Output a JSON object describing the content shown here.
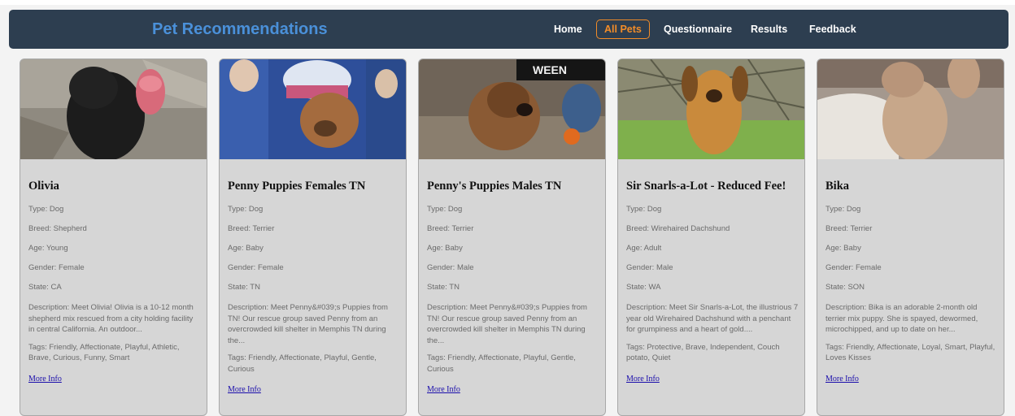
{
  "brand": "Pet Recommendations",
  "nav": [
    {
      "label": "Home",
      "active": false
    },
    {
      "label": "All Pets",
      "active": true
    },
    {
      "label": "Questionnaire",
      "active": false
    },
    {
      "label": "Results",
      "active": false
    },
    {
      "label": "Feedback",
      "active": false
    }
  ],
  "colors": {
    "navbar_bg": "#2d3e50",
    "brand": "#4a90d9",
    "active_nav": "#f28c28",
    "card_bg": "#d6d6d6",
    "link": "#1a0dab"
  },
  "pets": [
    {
      "name": "Olivia",
      "type": "Type: Dog",
      "breed": "Breed: Shepherd",
      "age": "Age: Young",
      "gender": "Gender: Female",
      "state": "State: CA",
      "description": "Description: Meet Olivia! Olivia is a 10-12 month shepherd mix rescued from a city holding facility in central California. An outdoor...",
      "tags": "Tags: Friendly, Affectionate, Playful, Athletic, Brave, Curious, Funny, Smart",
      "more": "More Info"
    },
    {
      "name": "Penny Puppies Females TN",
      "type": "Type: Dog",
      "breed": "Breed: Terrier",
      "age": "Age: Baby",
      "gender": "Gender: Female",
      "state": "State: TN",
      "description": "Description: Meet Penny&#039;s Puppies from TN! Our rescue group saved Penny from an overcrowded kill shelter in Memphis TN during the...",
      "tags": "Tags: Friendly, Affectionate, Playful, Gentle, Curious",
      "more": "More Info"
    },
    {
      "name": "Penny's Puppies Males TN",
      "type": "Type: Dog",
      "breed": "Breed: Terrier",
      "age": "Age: Baby",
      "gender": "Gender: Male",
      "state": "State: TN",
      "description": "Description: Meet Penny&#039;s Puppies from TN! Our rescue group saved Penny from an overcrowded kill shelter in Memphis TN during the...",
      "tags": "Tags: Friendly, Affectionate, Playful, Gentle, Curious",
      "more": "More Info"
    },
    {
      "name": "Sir Snarls-a-Lot - Reduced Fee!",
      "type": "Type: Dog",
      "breed": "Breed: Wirehaired Dachshund",
      "age": "Age: Adult",
      "gender": "Gender: Male",
      "state": "State: WA",
      "description": "Description: Meet Sir Snarls-a-Lot, the illustrious 7 year old Wirehaired Dachshund with a penchant for grumpiness and a heart of gold....",
      "tags": "Tags: Protective, Brave, Independent, Couch potato, Quiet",
      "more": "More Info"
    },
    {
      "name": "Bika",
      "type": "Type: Dog",
      "breed": "Breed: Terrier",
      "age": "Age: Baby",
      "gender": "Gender: Female",
      "state": "State: SON",
      "description": "Description: Bika is an adorable 2-month old terrier mix puppy. She is spayed, dewormed, microchipped, and up to date on her...",
      "tags": "Tags: Friendly, Affectionate, Loyal, Smart, Playful, Loves Kisses",
      "more": "More Info"
    }
  ],
  "photo_badge": "WEEN"
}
